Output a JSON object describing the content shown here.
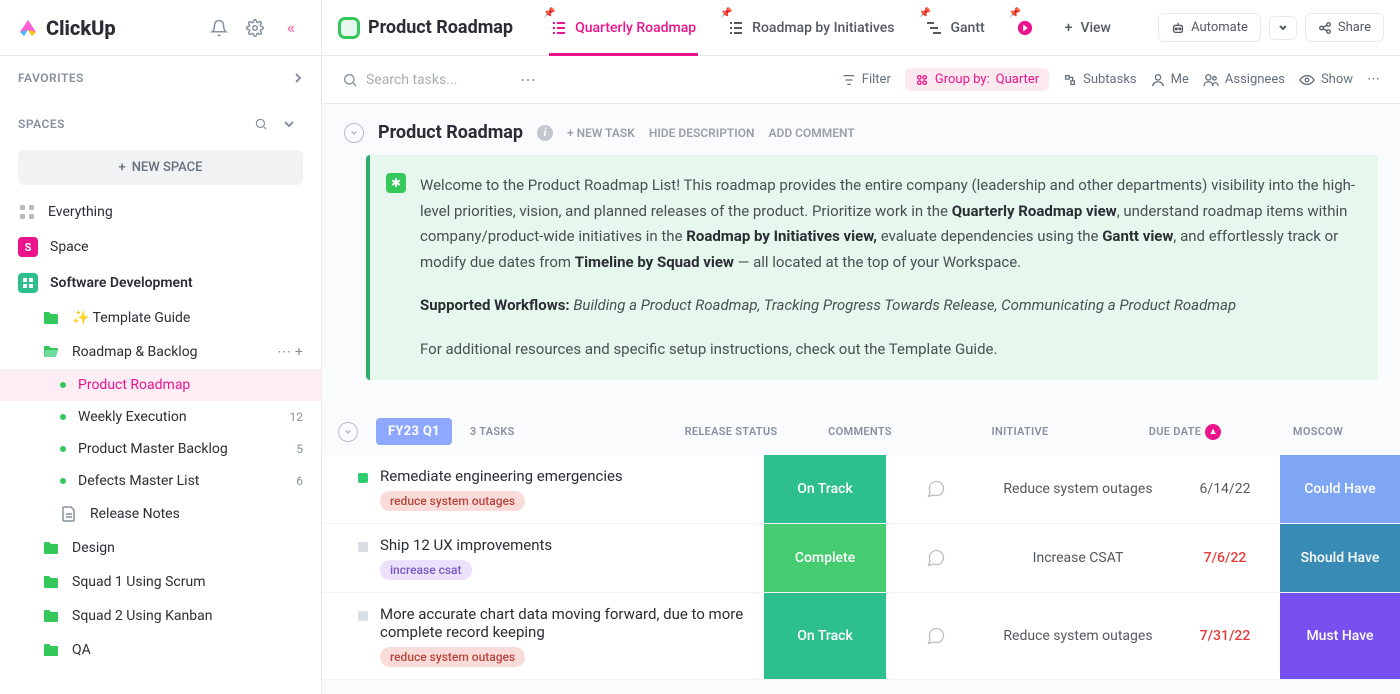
{
  "brand": "ClickUp",
  "sidebar": {
    "favorites_label": "FAVORITES",
    "spaces_label": "SPACES",
    "new_space_label": "NEW SPACE",
    "everything": "Everything",
    "space": "Space",
    "software_dev": "Software Development",
    "template_guide": "✨ Template Guide",
    "roadmap_backlog": "Roadmap & Backlog",
    "product_roadmap": "Product Roadmap",
    "weekly_execution": "Weekly Execution",
    "weekly_count": "12",
    "pmb": "Product Master Backlog",
    "pmb_count": "5",
    "defects": "Defects Master List",
    "defects_count": "6",
    "release_notes": "Release Notes",
    "design": "Design",
    "squad1": "Squad 1 Using Scrum",
    "squad2": "Squad 2 Using Kanban",
    "qa": "QA"
  },
  "header": {
    "title": "Product Roadmap",
    "tab_quarterly": "Quarterly Roadmap",
    "tab_initiatives": "Roadmap by Initiatives",
    "tab_gantt": "Gantt",
    "add_view": "View",
    "automate": "Automate",
    "share": "Share"
  },
  "toolbar": {
    "search_placeholder": "Search tasks...",
    "filter": "Filter",
    "group_prefix": "Group by:",
    "group_value": "Quarter",
    "subtasks": "Subtasks",
    "me": "Me",
    "assignees": "Assignees",
    "show": "Show"
  },
  "list": {
    "title": "Product Roadmap",
    "new_task": "+ NEW TASK",
    "hide_desc": "HIDE DESCRIPTION",
    "add_comment": "ADD COMMENT"
  },
  "description": {
    "p1a": "Welcome to the Product Roadmap List! This roadmap provides the entire company (leadership and other departments) visibility into the high-level priorities, vision, and planned releases of the product. Prioritize work in the ",
    "b1": "Quarterly Roadmap view",
    "p1b": ", understand roadmap items within company/product-wide initiatives in the ",
    "b2": "Roadmap by Initiatives view,",
    "p1c": " evaluate dependencies using the ",
    "b3": "Gantt view",
    "p1d": ", and effortlessly track or modify due dates from ",
    "b4": "Timeline by Squad view",
    "p1e": " — all located at the top of your Workspace.",
    "p2a": "Supported Workflows:",
    "p2b": " Building a Product Roadmap, Tracking Progress Towards Release, Communicating a Product Roadmap",
    "p3": "For additional resources and specific setup instructions, check out the Template Guide."
  },
  "group": {
    "name": "FY23 Q1",
    "count": "3 TASKS",
    "col_release": "RELEASE STATUS",
    "col_comments": "COMMENTS",
    "col_initiative": "INITIATIVE",
    "col_due": "DUE DATE",
    "col_moscow": "MOSCOW"
  },
  "release_labels": {
    "on_track": "On Track",
    "complete": "Complete"
  },
  "tasks": [
    {
      "title": "Remediate engineering emergencies",
      "tag": "reduce system outages",
      "tag_cls": "tag-red",
      "status_cls": "sq-green",
      "release": "on_track",
      "rel_cls": "rel-green",
      "initiative": "Reduce system outages",
      "due": "6/14/22",
      "due_cls": "",
      "moscow": "Could Have",
      "m_cls": "m-could"
    },
    {
      "title": "Ship 12 UX improvements",
      "tag": "increase csat",
      "tag_cls": "tag-purple",
      "status_cls": "sq-grey",
      "release": "complete",
      "rel_cls": "rel-lgreen",
      "initiative": "Increase CSAT",
      "due": "7/6/22",
      "due_cls": "due-red",
      "moscow": "Should Have",
      "m_cls": "m-should"
    },
    {
      "title": "More accurate chart data moving forward, due to more complete record keeping",
      "tag": "reduce system outages",
      "tag_cls": "tag-red",
      "status_cls": "sq-grey",
      "release": "on_track",
      "rel_cls": "rel-green",
      "initiative": "Reduce system outages",
      "due": "7/31/22",
      "due_cls": "due-red",
      "moscow": "Must Have",
      "m_cls": "m-must"
    }
  ]
}
